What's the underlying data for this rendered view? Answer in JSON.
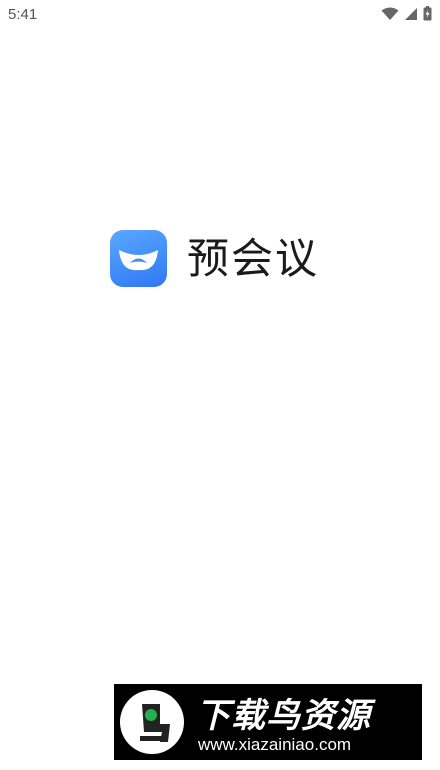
{
  "status_bar": {
    "time": "5:41",
    "icons": [
      "wifi-icon",
      "cellular-signal-icon",
      "battery-icon"
    ]
  },
  "splash": {
    "app_name": "预会议",
    "icon_name": "app-logo-icon",
    "accent_color": "#3b86f7"
  },
  "watermark": {
    "title": "下载鸟资源",
    "url": "www.xiazainiao.com"
  }
}
